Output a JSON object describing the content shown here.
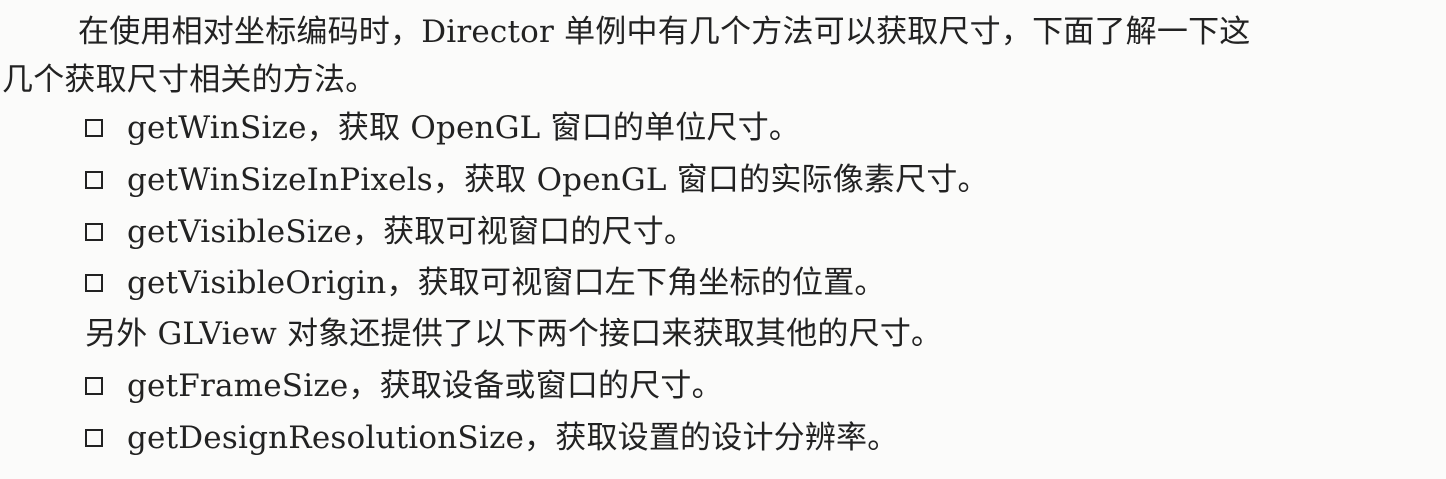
{
  "document": {
    "paragraph_1_line_1": "在使用相对坐标编码时，Director 单例中有几个方法可以获取尺寸，下面了解一下这",
    "paragraph_1_line_2": "几个获取尺寸相关的方法。",
    "list_1": [
      "getWinSize，获取 OpenGL 窗口的单位尺寸。",
      "getWinSizeInPixels，获取 OpenGL 窗口的实际像素尺寸。",
      "getVisibleSize，获取可视窗口的尺寸。",
      "getVisibleOrigin，获取可视窗口左下角坐标的位置。"
    ],
    "paragraph_2": "另外 GLView 对象还提供了以下两个接口来获取其他的尺寸。",
    "list_2": [
      "getFrameSize，获取设备或窗口的尺寸。",
      "getDesignResolutionSize，获取设置的设计分辨率。"
    ]
  }
}
